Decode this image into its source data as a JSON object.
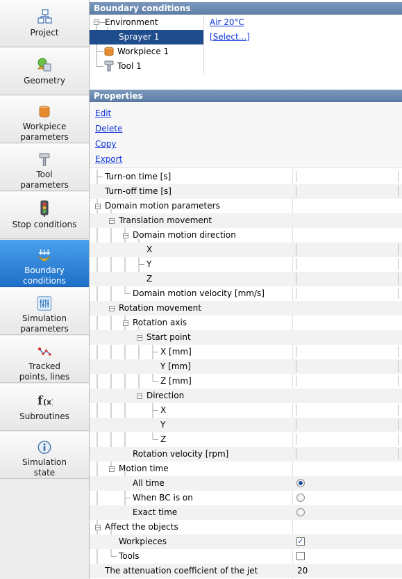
{
  "sidebar": {
    "items": [
      {
        "label": "Project",
        "icon": "project-icon"
      },
      {
        "label": "Geometry",
        "icon": "geometry-icon"
      },
      {
        "label": "Workpiece\nparameters",
        "icon": "workpiece-icon"
      },
      {
        "label": "Tool\nparameters",
        "icon": "tool-icon"
      },
      {
        "label": "Stop conditions",
        "icon": "traffic-light-icon"
      },
      {
        "label": "Boundary\nconditions",
        "icon": "boundary-conditions-icon"
      },
      {
        "label": "Simulation\nparameters",
        "icon": "sliders-icon"
      },
      {
        "label": "Tracked\npoints, lines",
        "icon": "tracked-points-icon"
      },
      {
        "label": "Subroutines",
        "icon": "function-icon"
      },
      {
        "label": "Simulation\nstate",
        "icon": "info-icon"
      }
    ],
    "active_index": 5
  },
  "boundary_conditions": {
    "title": "Boundary conditions",
    "tree": [
      {
        "label": "Environment",
        "value": "Air 20°C"
      },
      {
        "label": "Sprayer 1",
        "value": "[Select...]"
      },
      {
        "label": "Workpiece 1",
        "value": ""
      },
      {
        "label": "Tool 1",
        "value": ""
      }
    ]
  },
  "properties": {
    "title": "Properties",
    "actions": [
      "Edit",
      "Delete",
      "Copy",
      "Export"
    ],
    "rows": [
      {
        "label": "Turn-on time [s]"
      },
      {
        "label": "Turn-off time [s]"
      },
      {
        "label": "Domain motion parameters"
      },
      {
        "label": "Translation movement"
      },
      {
        "label": "Domain motion direction"
      },
      {
        "label": "X"
      },
      {
        "label": "Y"
      },
      {
        "label": "Z"
      },
      {
        "label": "Domain motion velocity [mm/s]"
      },
      {
        "label": "Rotation movement"
      },
      {
        "label": "Rotation axis"
      },
      {
        "label": "Start point"
      },
      {
        "label": "X [mm]"
      },
      {
        "label": "Y [mm]"
      },
      {
        "label": "Z [mm]"
      },
      {
        "label": "Direction"
      },
      {
        "label": "X"
      },
      {
        "label": "Y"
      },
      {
        "label": "Z"
      },
      {
        "label": "Rotation velocity [rpm]"
      },
      {
        "label": "Motion time"
      },
      {
        "label": "All time",
        "selected": true
      },
      {
        "label": "When BC is on",
        "selected": false
      },
      {
        "label": "Exact time",
        "selected": false
      },
      {
        "label": "Affect the objects"
      },
      {
        "label": "Workpieces",
        "checked": true
      },
      {
        "label": "Tools",
        "checked": false
      },
      {
        "label": "The attenuation coefficient of the jet",
        "value": "20"
      }
    ]
  },
  "colors": {
    "accent": "#1e6fc8",
    "header": "#6a88b0",
    "selection": "#1f4c8c",
    "link": "#0b33d9"
  }
}
